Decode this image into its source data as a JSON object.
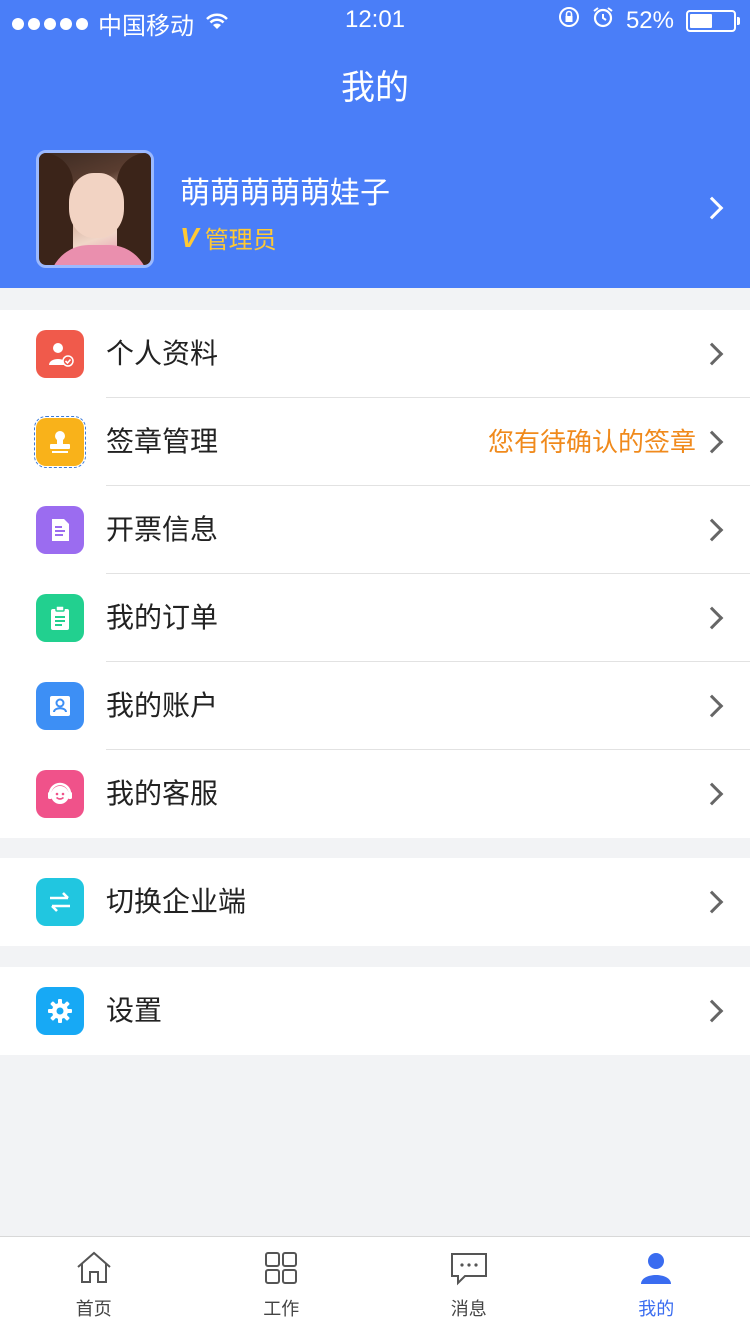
{
  "status_bar": {
    "carrier": "中国移动",
    "time": "12:01",
    "battery_percent": "52%",
    "battery_level": 0.52
  },
  "nav": {
    "title": "我的"
  },
  "profile": {
    "name": "萌萌萌萌萌娃子",
    "badge": "V",
    "role": "管理员"
  },
  "menu_main": [
    {
      "label": "个人资料",
      "icon": "user-verified-icon",
      "color": "#f05a4b"
    },
    {
      "label": "签章管理",
      "icon": "stamp-icon",
      "color": "#f9b21a",
      "note": "您有待确认的签章"
    },
    {
      "label": "开票信息",
      "icon": "invoice-icon",
      "color": "#9b6cf0"
    },
    {
      "label": "我的订单",
      "icon": "clipboard-icon",
      "color": "#22d08f"
    },
    {
      "label": "我的账户",
      "icon": "account-icon",
      "color": "#3d8ff5"
    },
    {
      "label": "我的客服",
      "icon": "customer-service-icon",
      "color": "#f0528a"
    }
  ],
  "menu_switch": {
    "label": "切换企业端",
    "icon": "switch-arrows-icon",
    "color": "#21c6e0"
  },
  "menu_settings": {
    "label": "设置",
    "icon": "gear-icon",
    "color": "#17a9f5"
  },
  "tabbar": [
    {
      "label": "首页",
      "icon": "home-icon"
    },
    {
      "label": "工作",
      "icon": "grid-icon"
    },
    {
      "label": "消息",
      "icon": "message-icon"
    },
    {
      "label": "我的",
      "icon": "person-icon",
      "active": true
    }
  ],
  "colors": {
    "header_blue": "#4a7ef8",
    "active_tab": "#3a6cf0",
    "note_orange": "#f08a1c",
    "role_gold": "#ffc934"
  }
}
